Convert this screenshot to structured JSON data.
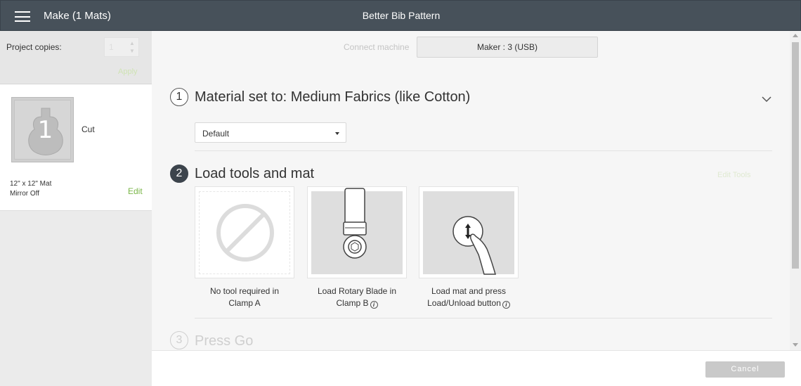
{
  "header": {
    "title": "Make (1 Mats)",
    "project_name": "Better Bib Pattern"
  },
  "sidebar": {
    "copies_label": "Project copies:",
    "copies_value": "1",
    "apply_label": "Apply",
    "mat": {
      "number": "1",
      "operation": "Cut",
      "size": "12\" x 12\" Mat",
      "mirror": "Mirror Off",
      "edit_label": "Edit"
    }
  },
  "main": {
    "connect_label": "Connect machine",
    "machine_button": "Maker : 3 (USB)",
    "step1": {
      "number": "1",
      "title": "Material set to: Medium Fabrics (like Cotton)",
      "pressure_value": "Default"
    },
    "step2": {
      "number": "2",
      "title": "Load tools and mat",
      "edit_tools_label": "Edit Tools",
      "tools": [
        {
          "line1": "No tool required in",
          "line2": "Clamp A"
        },
        {
          "line1": "Load Rotary Blade in",
          "line2": "Clamp B"
        },
        {
          "line1": "Load mat and press",
          "line2": "Load/Unload button"
        }
      ]
    },
    "step3": {
      "number": "3",
      "title": "Press Go"
    }
  },
  "footer": {
    "cancel_label": "Cancel"
  }
}
